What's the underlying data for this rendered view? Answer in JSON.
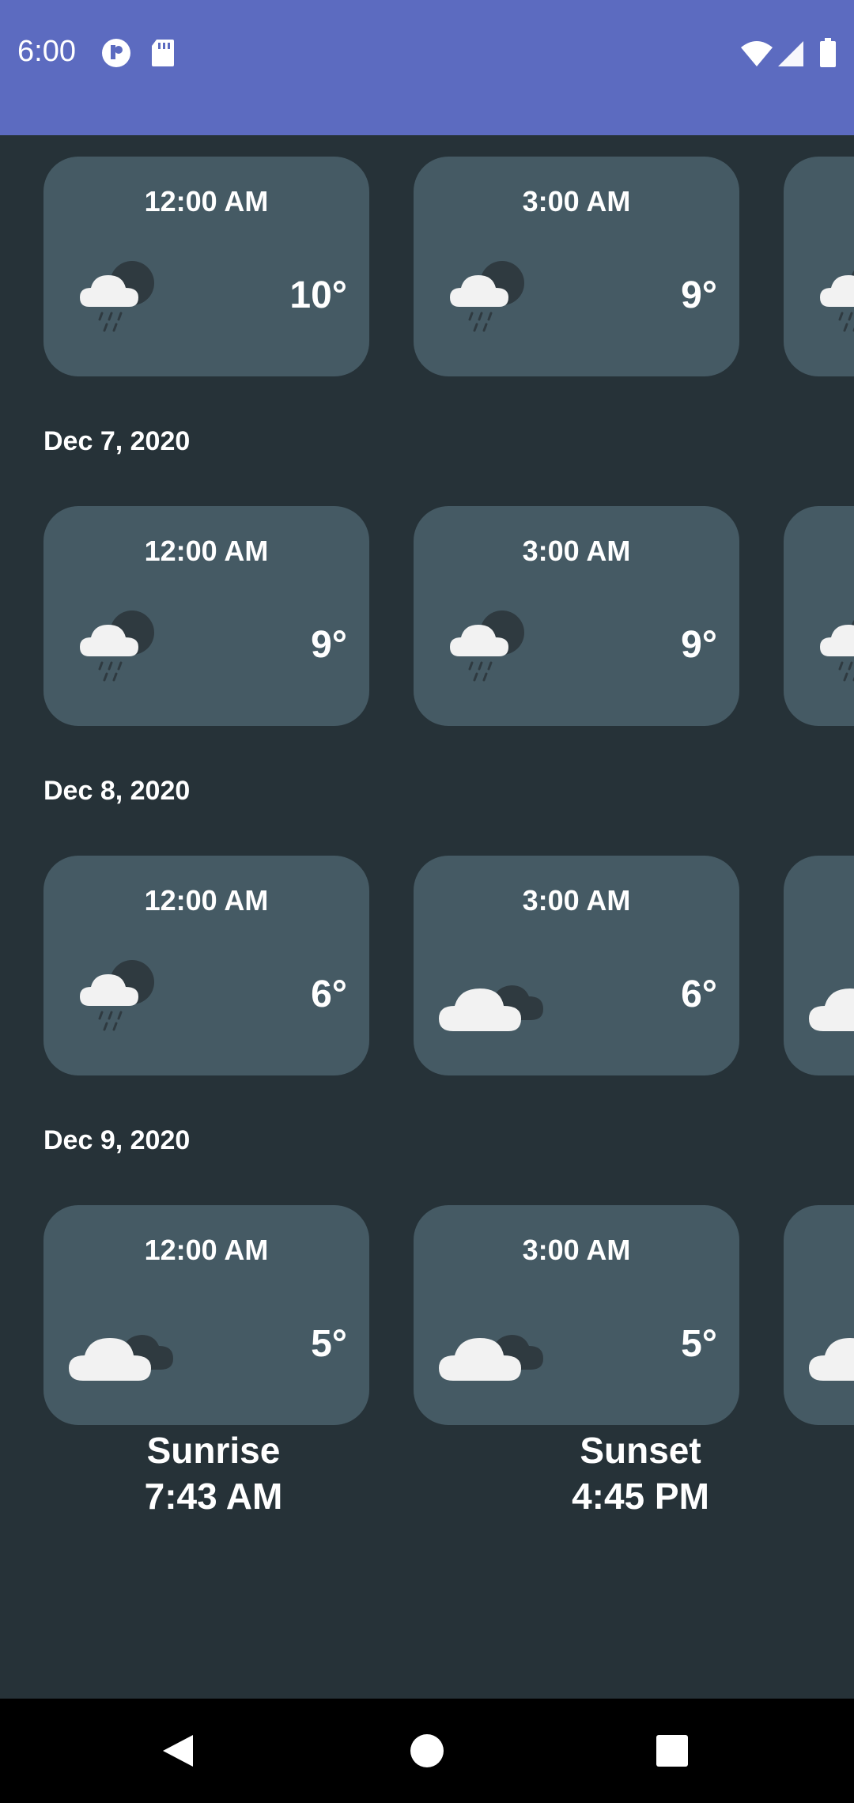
{
  "status_bar": {
    "time": "6:00"
  },
  "forecast_groups": [
    {
      "date": "",
      "cards": [
        {
          "time": "12:00 AM",
          "temp": "10°",
          "icon": "rain-cloud-icon"
        },
        {
          "time": "3:00 AM",
          "temp": "9°",
          "icon": "rain-cloud-icon"
        },
        {
          "time": "",
          "temp": "",
          "icon": "rain-cloud-icon"
        }
      ]
    },
    {
      "date": "Dec 7, 2020",
      "cards": [
        {
          "time": "12:00 AM",
          "temp": "9°",
          "icon": "rain-cloud-icon"
        },
        {
          "time": "3:00 AM",
          "temp": "9°",
          "icon": "rain-cloud-icon"
        },
        {
          "time": "",
          "temp": "",
          "icon": "rain-cloud-icon"
        }
      ]
    },
    {
      "date": "Dec 8, 2020",
      "cards": [
        {
          "time": "12:00 AM",
          "temp": "6°",
          "icon": "rain-cloud-icon"
        },
        {
          "time": "3:00 AM",
          "temp": "6°",
          "icon": "cloudy-icon"
        },
        {
          "time": "",
          "temp": "",
          "icon": "cloudy-icon"
        }
      ]
    },
    {
      "date": "Dec 9, 2020",
      "cards": [
        {
          "time": "12:00 AM",
          "temp": "5°",
          "icon": "cloudy-icon"
        },
        {
          "time": "3:00 AM",
          "temp": "5°",
          "icon": "cloudy-icon"
        },
        {
          "time": "",
          "temp": "",
          "icon": "cloudy-icon"
        }
      ]
    }
  ],
  "sun": {
    "sunrise_label": "Sunrise",
    "sunrise_time": "7:43 AM",
    "sunset_label": "Sunset",
    "sunset_time": "4:45 PM"
  },
  "colors": {
    "status_bar": "#5c6bc0",
    "background": "#263238",
    "card": "#455a64"
  }
}
